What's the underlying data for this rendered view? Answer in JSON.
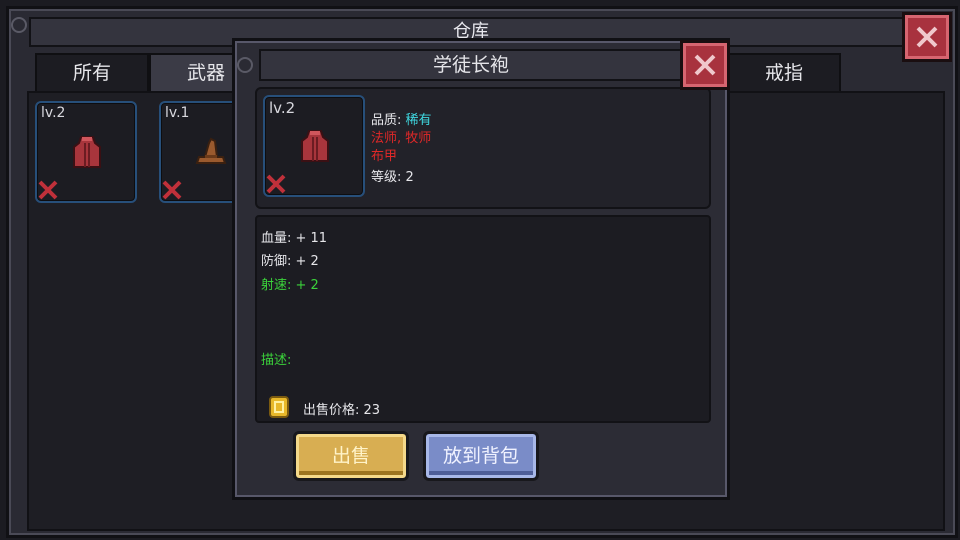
{
  "window": {
    "title": "仓库"
  },
  "tabs": [
    {
      "label": "所有"
    },
    {
      "label": "武器"
    },
    {
      "label": "戒指"
    }
  ],
  "inventory": [
    {
      "level": "lv.2",
      "item_icon": "robe-icon",
      "item_color": "#a8353c"
    },
    {
      "level": "lv.1",
      "item_icon": "wizard-hat-icon",
      "item_color": "#9a5a2e"
    }
  ],
  "popup": {
    "title": "学徒长袍",
    "item_level": "lv.2",
    "quality_label": "品质: ",
    "quality_value": "稀有",
    "classes": "法师, 牧师",
    "armor_type": "布甲",
    "level_text": "等级: 2",
    "stats": [
      {
        "text": "血量: + 11",
        "color": "#e6e6ea"
      },
      {
        "text": "防御: + 2",
        "color": "#e6e6ea"
      },
      {
        "text": "射速: + 2",
        "color": "#3bd23b"
      }
    ],
    "description_label": "描述:",
    "sell_price": "出售价格: 23",
    "sell_button": "出售",
    "to_bag_button": "放到背包"
  },
  "colors": {
    "quality_rare": "#3fd8e0",
    "class_text": "#e02828",
    "description": "#3bd23b",
    "close_red": "#a8323e"
  }
}
